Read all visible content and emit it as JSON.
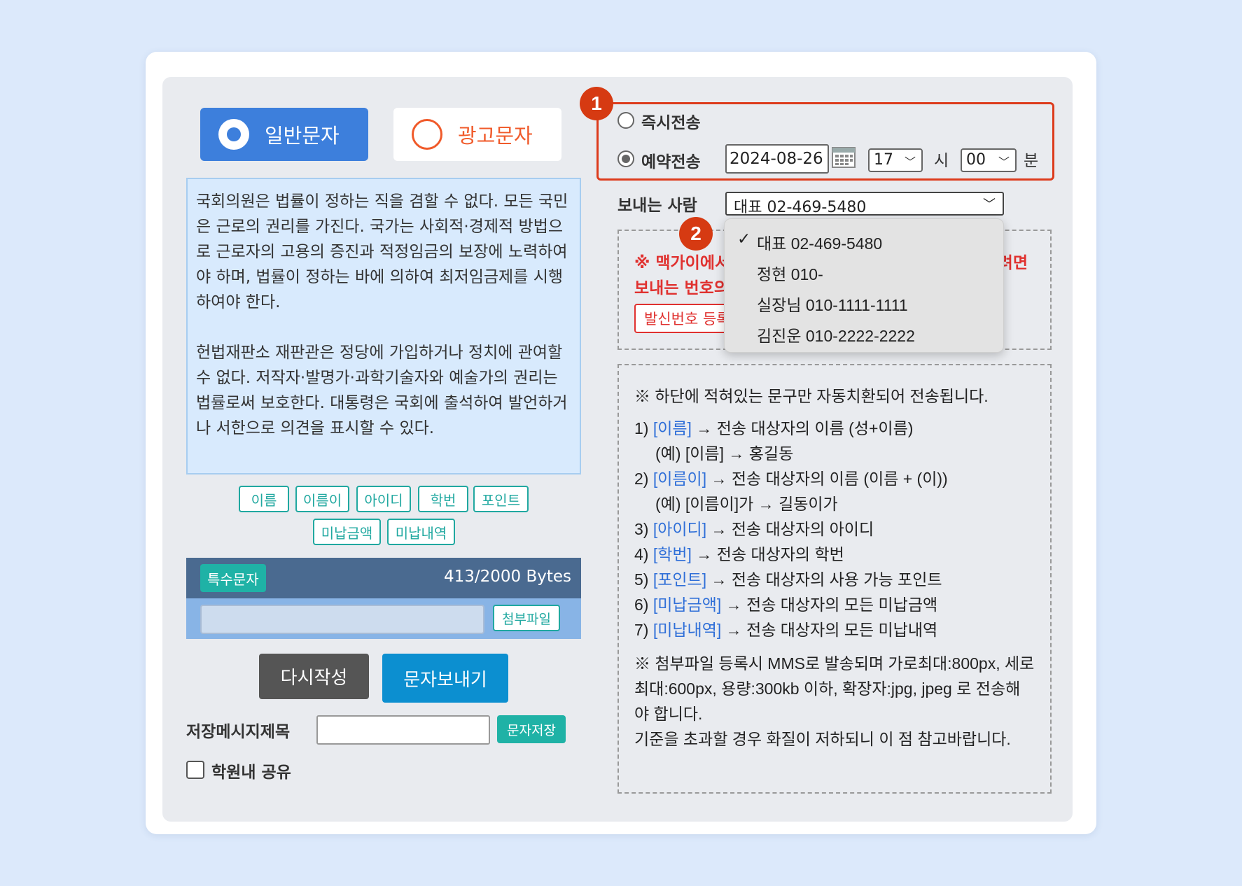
{
  "colors": {
    "accent": "#3d7fdc",
    "ad": "#f05a2a",
    "teal": "#1fb2a6",
    "highlight": "#dd3b1c",
    "warning": "#e0312f"
  },
  "type_buttons": {
    "general": "일반문자",
    "ad": "광고문자"
  },
  "message": "국회의원은 법률이 정하는 직을 겸할 수 없다. 모든 국민은 근로의 권리를 가진다. 국가는 사회적·경제적 방법으로 근로자의 고용의 증진과 적정임금의 보장에 노력하여야 하며, 법률이 정하는 바에 의하여 최저임금제를 시행하여야 한다.\n\n헌법재판소 재판관은 정당에 가입하거나 정치에 관여할 수 없다. 저작자·발명가·과학기술자와 예술가의 권리는 법률로써 보호한다. 대통령은 국회에 출석하여 발언하거나 서한으로 의견을 표시할 수 있다.",
  "tags": [
    "이름",
    "이름이",
    "아이디",
    "학번",
    "포인트",
    "미납금액",
    "미납내역"
  ],
  "special_chars": "특수문자",
  "bytes": "413/2000 Bytes",
  "attach": "첨부파일",
  "rewrite": "다시작성",
  "send": "문자보내기",
  "save_title_label": "저장메시지제목",
  "save_button": "문자저장",
  "share_label": "학원내 공유",
  "badges": [
    "1",
    "2"
  ],
  "schedule": {
    "instant": "즉시전송",
    "reserved": "예약전송",
    "date": "2024-08-26",
    "hour": "17",
    "hour_unit": "시",
    "minute": "00",
    "minute_unit": "분",
    "selected": "reserved"
  },
  "sender": {
    "label": "보내는 사람",
    "selected": "대표 02-469-5480",
    "options": [
      "대표 02-469-5480",
      "정현 010-",
      "실장님 010-1111-1111",
      "김진운 010-2222-2222"
    ]
  },
  "warning": {
    "line1_left": "※ 맥가이에서",
    "line1_right": "려면",
    "line2": "보내는 번호의",
    "register_btn": "발신번호 등록"
  },
  "info": {
    "header": "※ 하단에 적혀있는 문구만 자동치환되어 전송됩니다.",
    "items": [
      {
        "num": "1)",
        "var": "[이름]",
        "desc": " → 전송 대상자의 이름 (성+이름)",
        "example": "(예) [이름] → 홍길동"
      },
      {
        "num": "2)",
        "var": "[이름이]",
        "desc": " → 전송 대상자의 이름 (이름 + (이))",
        "example": "(예) [이름이]가 → 길동이가"
      },
      {
        "num": "3)",
        "var": "[아이디]",
        "desc": " → 전송 대상자의 아이디"
      },
      {
        "num": "4)",
        "var": "[학번]",
        "desc": " → 전송 대상자의 학번"
      },
      {
        "num": "5)",
        "var": "[포인트]",
        "desc": " → 전송 대상자의 사용 가능 포인트"
      },
      {
        "num": "6)",
        "var": "[미납금액]",
        "desc": " → 전송 대상자의 모든 미납금액"
      },
      {
        "num": "7)",
        "var": "[미납내역]",
        "desc": " → 전송 대상자의 모든 미납내역"
      }
    ],
    "note1": "※ 첨부파일 등록시 MMS로 발송되며 가로최대:800px, 세로최대:600px, 용량:300kb 이하, 확장자:jpg, jpeg 로 전송해야 합니다.",
    "note2": "기준을 초과할 경우 화질이 저하되니 이 점 참고바랍니다."
  }
}
